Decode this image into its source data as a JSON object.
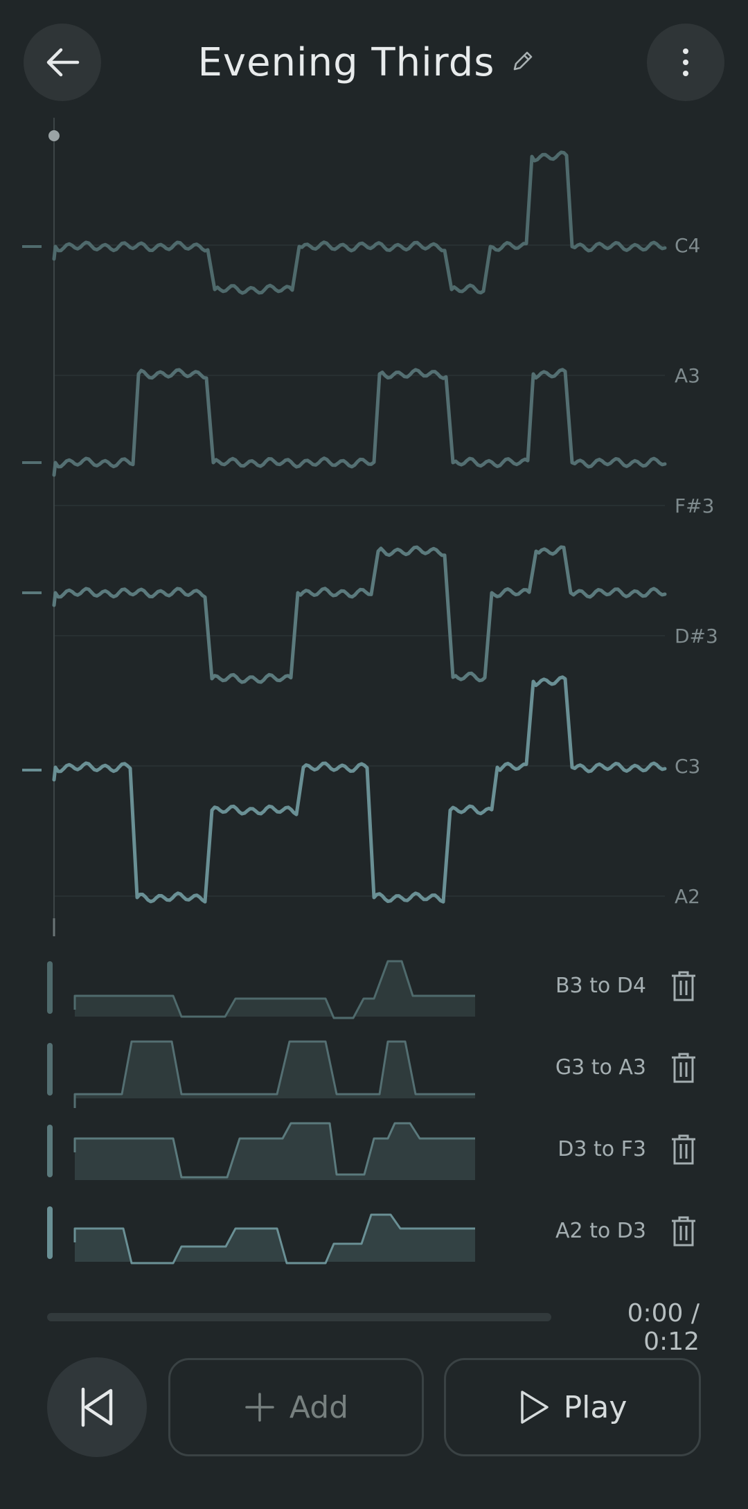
{
  "header": {
    "title": "Evening Thirds",
    "back_icon": "arrow-left-icon",
    "edit_icon": "pencil-icon",
    "menu_icon": "more-vertical-icon"
  },
  "pitch_axis": {
    "labels": [
      "C4",
      "A3",
      "F#3",
      "D#3",
      "C3",
      "A2"
    ]
  },
  "colors": {
    "background": "#202628",
    "lane_1": "#4f6a6c",
    "lane_2": "#546f72",
    "lane_3": "#5b7a7d",
    "lane_4": "#6a9095"
  },
  "tracks": [
    {
      "label": "B3 to D4",
      "delete_icon": "trash-icon"
    },
    {
      "label": "G3 to A3",
      "delete_icon": "trash-icon"
    },
    {
      "label": "D3 to F3",
      "delete_icon": "trash-icon"
    },
    {
      "label": "A2 to D3",
      "delete_icon": "trash-icon"
    }
  ],
  "playback": {
    "time": "0:00 / 0:12",
    "progress": 0
  },
  "controls": {
    "rewind_icon": "skip-back-icon",
    "add_label": "Add",
    "add_icon": "plus-icon",
    "play_label": "Play",
    "play_icon": "play-icon"
  }
}
